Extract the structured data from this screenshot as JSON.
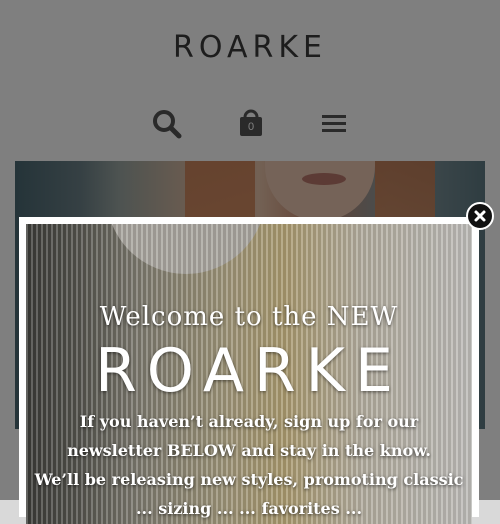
{
  "header": {
    "logo_text": "ROARKE",
    "cart_count": "0",
    "icons": {
      "search": "search-icon",
      "cart": "shopping-bag-icon",
      "menu": "hamburger-menu-icon"
    }
  },
  "modal": {
    "title": "Welcome to the NEW",
    "brand": "ROARKE",
    "body_lines": [
      "If you haven’t already, sign up for our",
      "newsletter BELOW and stay in the know.",
      "We’ll be releasing new styles, promoting classic",
      "... sizing ... ... favorites ..."
    ],
    "close_icon": "close-icon"
  },
  "colors": {
    "logo": "#3a3a3a",
    "icon": "#555555",
    "overlay": "rgba(0,0,0,0.5)",
    "close_button": "#111111"
  }
}
